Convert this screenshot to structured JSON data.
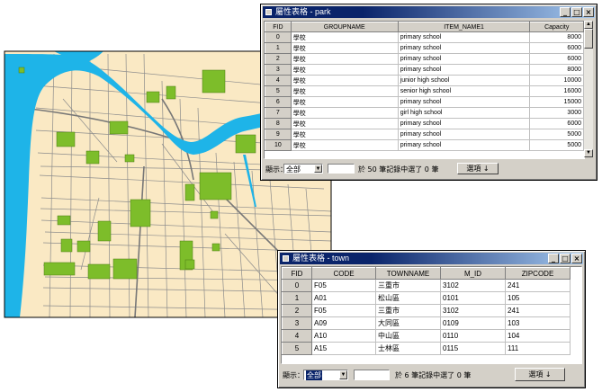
{
  "park_window": {
    "title": "屬性表格 - park",
    "columns": [
      "FID",
      "GROUPNAME",
      "ITEM_NAME1",
      "Capacity"
    ],
    "rows": [
      [
        "0",
        "學校",
        "primary school",
        "8000"
      ],
      [
        "1",
        "學校",
        "primary school",
        "6000"
      ],
      [
        "2",
        "學校",
        "primary school",
        "6000"
      ],
      [
        "3",
        "學校",
        "primary school",
        "8000"
      ],
      [
        "4",
        "學校",
        "junior high school",
        "10000"
      ],
      [
        "5",
        "學校",
        "senior high school",
        "16000"
      ],
      [
        "6",
        "學校",
        "primary school",
        "15000"
      ],
      [
        "7",
        "學校",
        "girl high school",
        "3000"
      ],
      [
        "8",
        "學校",
        "primary school",
        "6000"
      ],
      [
        "9",
        "學校",
        "primary school",
        "5000"
      ],
      [
        "10",
        "學校",
        "primary school",
        "5000"
      ]
    ],
    "footer": {
      "show_label": "顯示：",
      "show_value": "全部",
      "status": "於 50 筆記錄中選了 0 筆",
      "options_label": "選項 ↓"
    }
  },
  "town_window": {
    "title": "屬性表格 - town",
    "columns": [
      "FID",
      "CODE",
      "TOWNNAME",
      "M_ID",
      "ZIPCODE"
    ],
    "rows": [
      [
        "0",
        "F05",
        "三重市",
        "3102",
        "241"
      ],
      [
        "1",
        "A01",
        "松山區",
        "0101",
        "105"
      ],
      [
        "2",
        "F05",
        "三重市",
        "3102",
        "241"
      ],
      [
        "3",
        "A09",
        "大同區",
        "0109",
        "103"
      ],
      [
        "4",
        "A10",
        "中山區",
        "0110",
        "104"
      ],
      [
        "5",
        "A15",
        "士林區",
        "0115",
        "111"
      ]
    ],
    "footer": {
      "show_label": "顯示：",
      "show_value": "全部",
      "status": "於 6 筆記錄中選了 0 筆",
      "options_label": "選項 ↓"
    }
  },
  "map": {
    "land_color": "#fae9c4",
    "water_color": "#1eb4e8",
    "park_color": "#7dbd2a",
    "road_color": "#909090"
  }
}
